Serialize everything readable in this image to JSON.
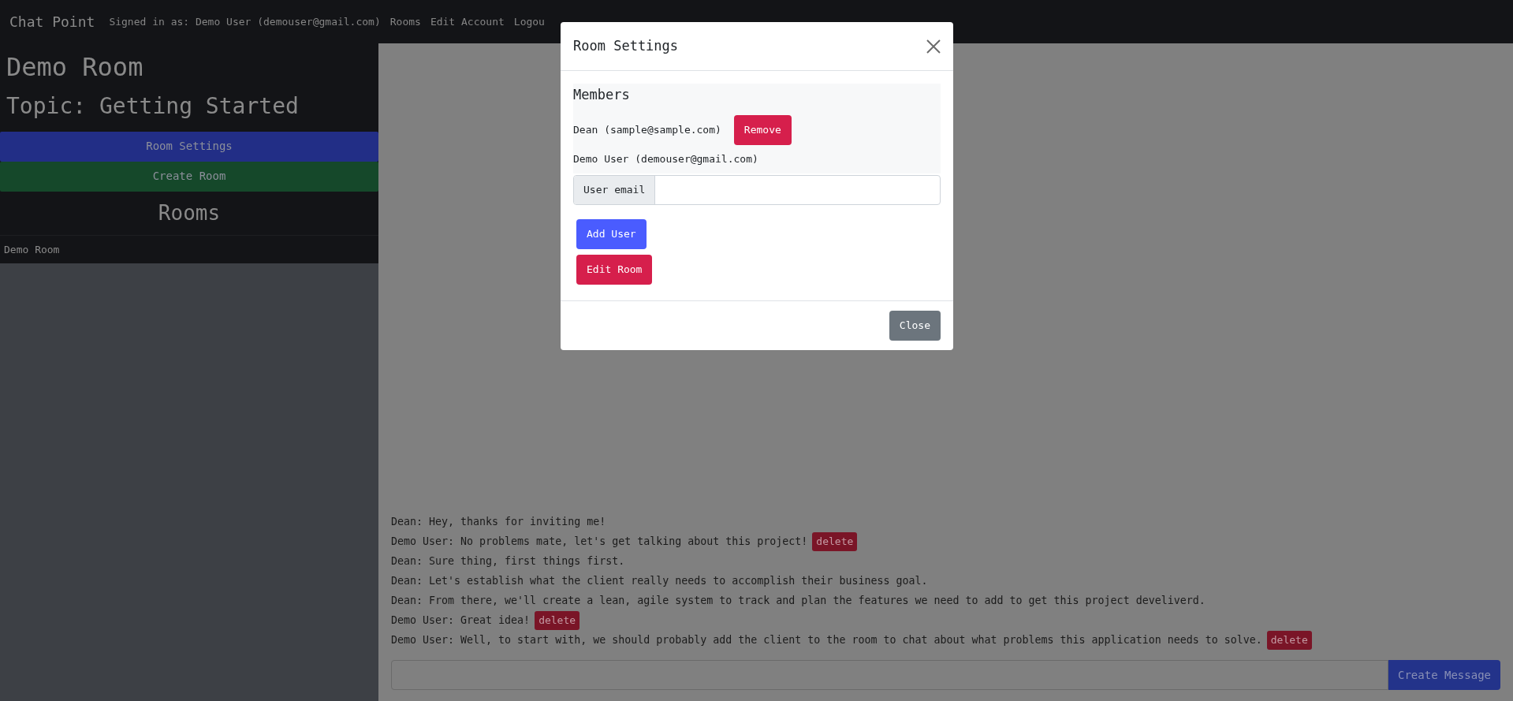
{
  "navbar": {
    "brand": "Chat Point",
    "signed_in": "Signed in as: Demo User (demouser@gmail.com)",
    "links": [
      "Rooms",
      "Edit Account",
      "Logou"
    ]
  },
  "sidebar": {
    "room_title": "Demo Room",
    "topic": "Topic: Getting Started",
    "buttons": [
      {
        "label": "Room Settings",
        "kind": "primary"
      },
      {
        "label": "Create Room",
        "kind": "success"
      }
    ],
    "rooms_heading": "Rooms",
    "rooms": [
      "Demo Room"
    ]
  },
  "messages": [
    {
      "text": "Dean: Hey, thanks for inviting me!"
    },
    {
      "text": "Demo User: No problems mate, let's get talking about this project!",
      "delete": "delete"
    },
    {
      "text": "Dean: Sure thing, first things first."
    },
    {
      "text": "Dean: Let's establish what the client really needs to accomplish their business goal."
    },
    {
      "text": "Dean: From there, we'll create a lean, agile system to track and plan the features we need to add to get this project develiverd."
    },
    {
      "text": "Demo User: Great idea!",
      "delete": "delete"
    },
    {
      "text": "Demo User: Well, to start with, we should probably add the client to the room to chat about what problems this application needs to solve.",
      "delete": "delete"
    }
  ],
  "composer": {
    "button": "Create Message"
  },
  "modal": {
    "title": "Room Settings",
    "members_heading": "Members",
    "members": [
      {
        "label": "Dean (sample@sample.com)",
        "action": "Remove"
      },
      {
        "label": "Demo User (demouser@gmail.com)"
      }
    ],
    "input_addon": "User email",
    "buttons": [
      {
        "label": "Add User",
        "kind": "primary"
      },
      {
        "label": "Edit Room",
        "kind": "danger"
      }
    ],
    "footer_button": "Close"
  }
}
